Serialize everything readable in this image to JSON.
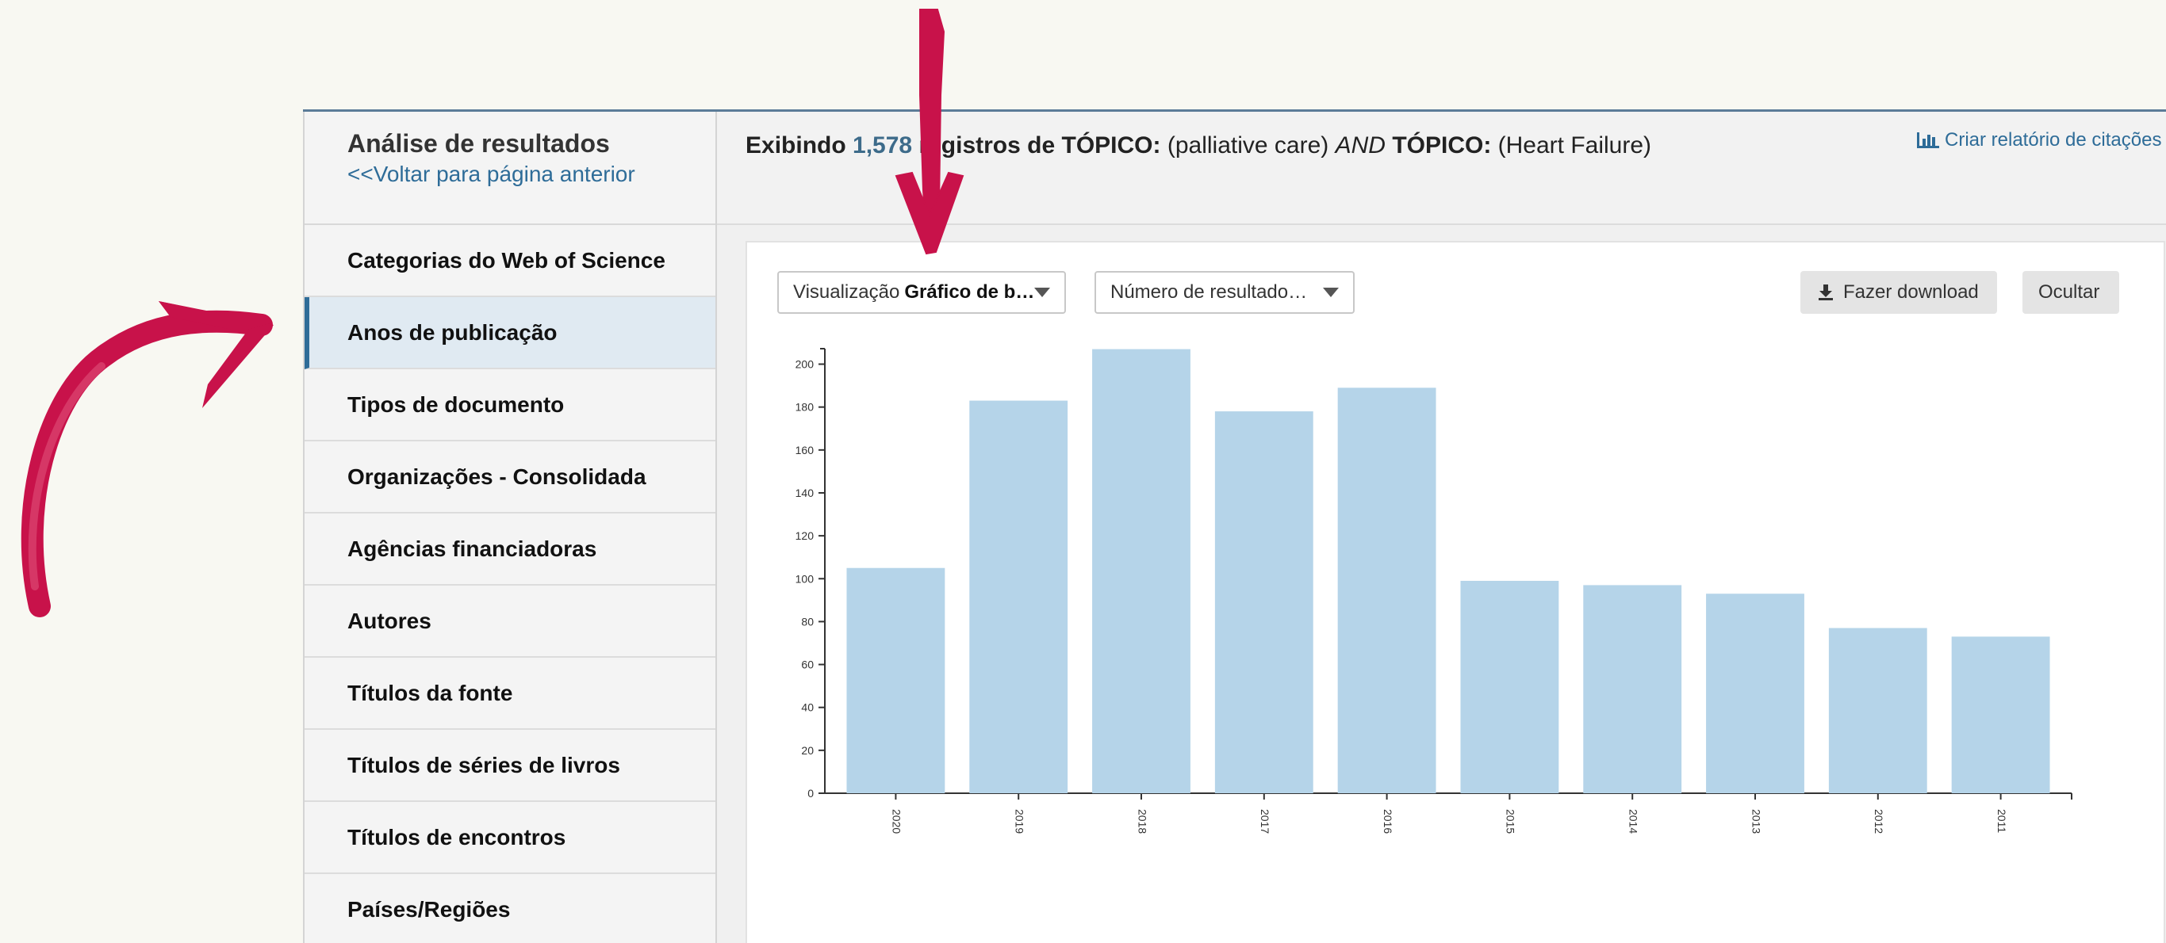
{
  "sidebar": {
    "title": "Análise de resultados",
    "back_link": "<<Voltar para página anterior",
    "items": [
      {
        "label": "Categorias do Web of Science"
      },
      {
        "label": "Anos de publicação"
      },
      {
        "label": "Tipos de documento"
      },
      {
        "label": "Organizações - Consolidada"
      },
      {
        "label": "Agências financiadoras"
      },
      {
        "label": "Autores"
      },
      {
        "label": "Títulos da fonte"
      },
      {
        "label": "Títulos de séries de livros"
      },
      {
        "label": "Títulos de encontros"
      },
      {
        "label": "Países/Regiões"
      }
    ],
    "active_item": "Anos de publicação"
  },
  "header": {
    "prefix": "Exibindo",
    "count": "1,578",
    "suffix": "registros de",
    "topic1_label": "TÓPICO:",
    "topic1_value": "(palliative care)",
    "operator": "AND",
    "topic2_label": "TÓPICO:",
    "topic2_value": "(Heart Failure)",
    "report_link": "Criar relatório de citações",
    "report_icon": "bar-chart-icon"
  },
  "controls": {
    "visualization_prefix": "Visualização",
    "visualization_value": "Gráfico de b…",
    "results_select": "Número de resultado…",
    "download_button": "Fazer download",
    "download_icon": "download-icon",
    "hide_button": "Ocultar"
  },
  "chart_data": {
    "type": "bar",
    "categories": [
      "2020",
      "2019",
      "2018",
      "2017",
      "2016",
      "2015",
      "2014",
      "2013",
      "2012",
      "2011"
    ],
    "values": [
      105,
      183,
      207,
      178,
      189,
      99,
      97,
      93,
      77,
      73
    ],
    "title": "",
    "xlabel": "",
    "ylabel": "",
    "ylim": [
      0,
      205
    ],
    "yticks": [
      0,
      20,
      40,
      60,
      80,
      100,
      120,
      140,
      160,
      180,
      200
    ],
    "bar_color": "#b5d4e9",
    "grid": false
  },
  "colors": {
    "accent": "#2e6c98",
    "annotation": "#c8124a"
  }
}
